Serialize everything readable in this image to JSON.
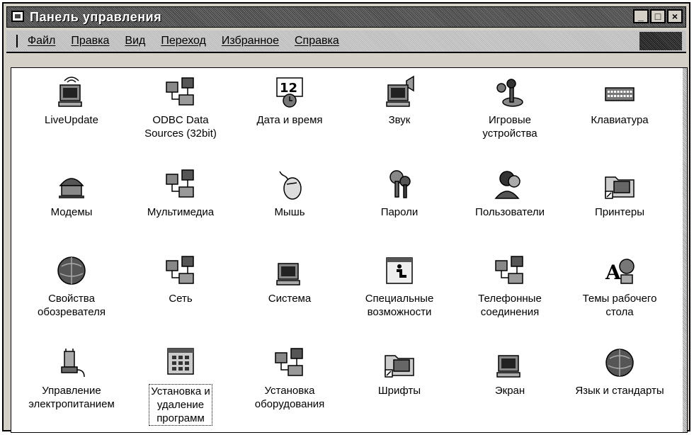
{
  "window": {
    "title": "Панель управления",
    "controls": {
      "minimize": "_",
      "maximize": "□",
      "close": "×"
    }
  },
  "menu": {
    "items": [
      "Файл",
      "Правка",
      "Вид",
      "Переход",
      "Избранное",
      "Справка"
    ]
  },
  "icons": [
    {
      "label": "LiveUpdate",
      "icon": "antenna-computer-icon"
    },
    {
      "label": "ODBC Data\nSources (32bit)",
      "icon": "database-icon"
    },
    {
      "label": "Дата и время",
      "icon": "calendar-clock-icon"
    },
    {
      "label": "Звук",
      "icon": "speaker-icon"
    },
    {
      "label": "Игровые\nустройства",
      "icon": "joystick-icon"
    },
    {
      "label": "Клавиатура",
      "icon": "keyboard-icon"
    },
    {
      "label": "Модемы",
      "icon": "modem-phone-icon"
    },
    {
      "label": "Мультимедиа",
      "icon": "multimedia-icon"
    },
    {
      "label": "Мышь",
      "icon": "mouse-icon"
    },
    {
      "label": "Пароли",
      "icon": "keys-icon"
    },
    {
      "label": "Пользователи",
      "icon": "users-icon"
    },
    {
      "label": "Принтеры",
      "icon": "printer-folder-icon"
    },
    {
      "label": "Свойства\nобозревателя",
      "icon": "globe-icon"
    },
    {
      "label": "Сеть",
      "icon": "network-icon"
    },
    {
      "label": "Система",
      "icon": "computer-icon"
    },
    {
      "label": "Специальные\nвозможности",
      "icon": "accessibility-icon"
    },
    {
      "label": "Телефонные\nсоединения",
      "icon": "telephony-icon"
    },
    {
      "label": "Темы рабочего\nстола",
      "icon": "desktop-themes-icon"
    },
    {
      "label": "Управление\nэлектропитанием",
      "icon": "power-plug-icon"
    },
    {
      "label": "Установка и\nудаление\nпрограмм",
      "icon": "add-remove-programs-icon",
      "selected": true
    },
    {
      "label": "Установка\nоборудования",
      "icon": "hardware-icon"
    },
    {
      "label": "Шрифты",
      "icon": "fonts-folder-icon"
    },
    {
      "label": "Экран",
      "icon": "monitor-icon"
    },
    {
      "label": "Язык и стандарты",
      "icon": "world-globe-icon"
    }
  ]
}
